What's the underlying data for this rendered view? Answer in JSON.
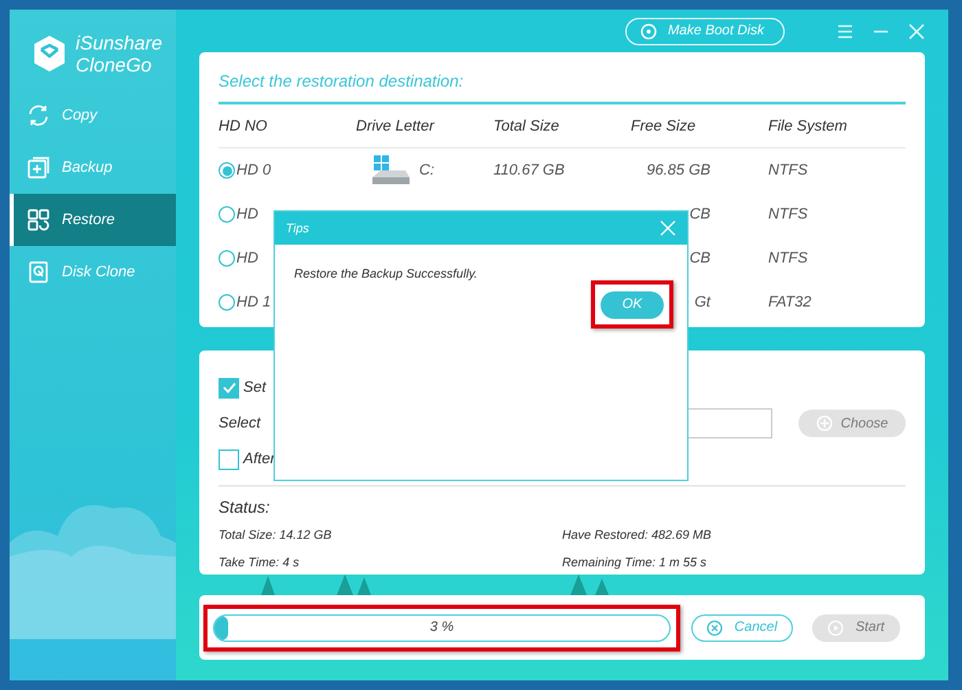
{
  "app": {
    "name_line_1": "iSunshare",
    "name_line_2": "CloneGo"
  },
  "sidebar": {
    "items": [
      {
        "label": "Copy",
        "kind": "copy",
        "selected": false
      },
      {
        "label": "Backup",
        "kind": "backup",
        "selected": false
      },
      {
        "label": "Restore",
        "kind": "restore",
        "selected": true
      },
      {
        "label": "Disk Clone",
        "kind": "clone",
        "selected": false
      }
    ]
  },
  "top_bar": {
    "boot_button": "Make Boot Disk"
  },
  "destination": {
    "title": "Select the restoration destination:",
    "columns": [
      "HD NO",
      "Drive Letter",
      "Total Size",
      "Free Size",
      "File System"
    ],
    "rows": [
      {
        "hd": "HD 0",
        "selected": true,
        "drive": "C:",
        "total": "110.67 GB",
        "free": "96.85 GB",
        "fs": "NTFS"
      },
      {
        "hd": "HD",
        "selected": false,
        "drive": "",
        "total": "",
        "free": "CB",
        "fs": "NTFS"
      },
      {
        "hd": "HD",
        "selected": false,
        "drive": "",
        "total": "",
        "free": "CB",
        "fs": "NTFS"
      },
      {
        "hd": "HD 1",
        "selected": false,
        "drive": "",
        "total": "",
        "free": "Gt",
        "fs": "FAT32"
      }
    ]
  },
  "options": {
    "set": {
      "label": "Set",
      "checked": true
    },
    "select_label": "Select",
    "choose_button": "Choose",
    "choose_disabled": true,
    "after": {
      "label": "After",
      "checked": false
    }
  },
  "status": {
    "title": "Status:",
    "total_size": "Total Size: 14.12 GB",
    "take_time": "Take Time: 4 s",
    "have_restored": "Have Restored: 482.69 MB",
    "remaining": "Remaining Time: 1 m 55 s"
  },
  "progress": {
    "level": 0.03,
    "text": "3 %",
    "highlighted": true
  },
  "buttons": {
    "cancel": "Cancel",
    "start": "Start",
    "start_disabled": true
  },
  "dialog": {
    "title": "Tips",
    "message": "Restore the Backup Successfully.",
    "ok": "OK",
    "ok_highlighted": true
  }
}
